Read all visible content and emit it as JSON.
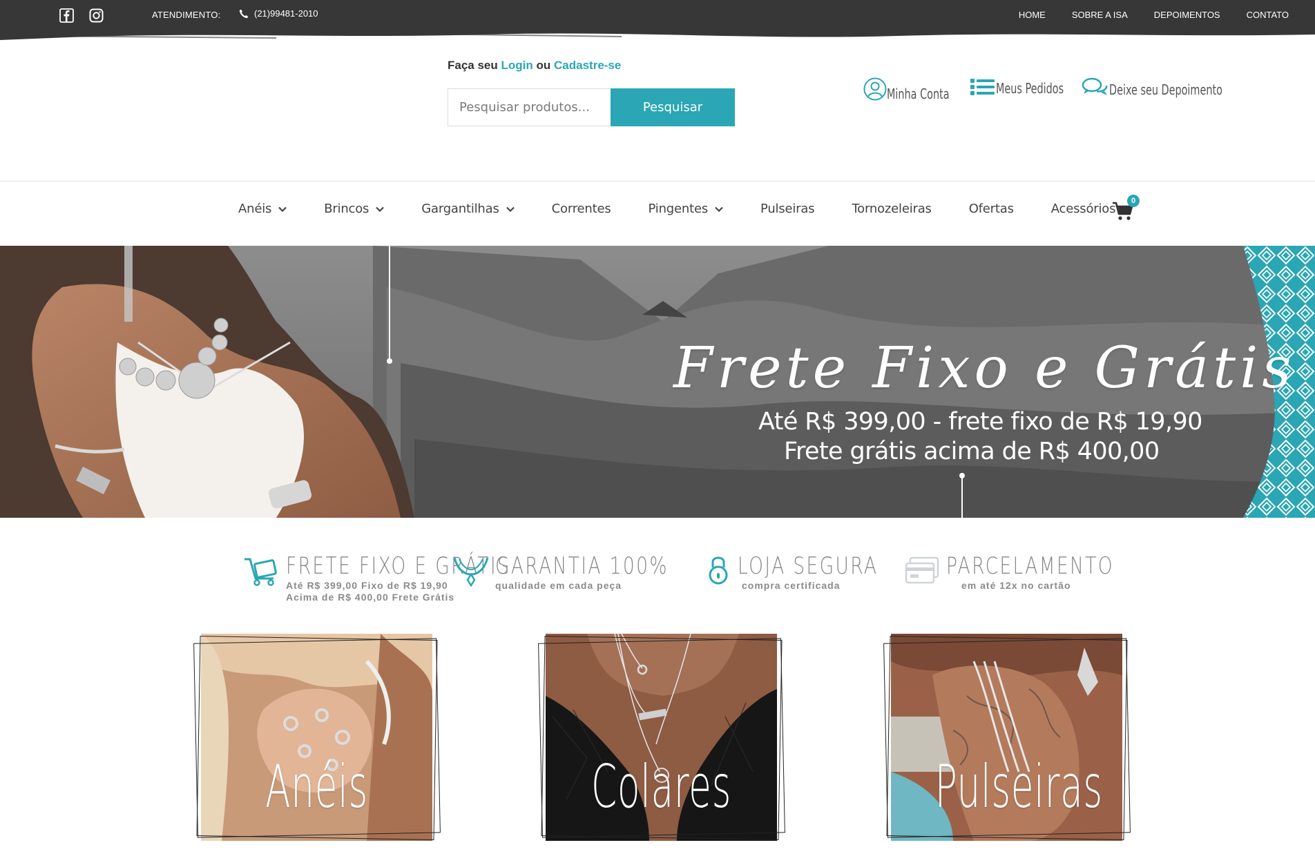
{
  "topbar": {
    "social": [
      {
        "icon": "facebook-icon"
      },
      {
        "icon": "instagram-icon"
      }
    ],
    "atendimento_label": "ATENDIMENTO:",
    "phone": "(21)99481-2010",
    "nav": [
      "HOME",
      "SOBRE A ISA",
      "DEPOIMENTOS",
      "CONTATO"
    ]
  },
  "header": {
    "login_prefix": "Faça seu",
    "login_link": "Login",
    "login_middle": "ou",
    "register_link": "Cadastre-se",
    "search": {
      "placeholder": "Pesquisar produtos...",
      "button": "Pesquisar"
    },
    "links": [
      {
        "label": "Minha Conta",
        "icon": "user-icon"
      },
      {
        "label": "Meus Pedidos",
        "icon": "list-icon"
      },
      {
        "label": "Deixe seu Depoimento",
        "icon": "chat-icon"
      }
    ]
  },
  "mainnav": {
    "items": [
      {
        "label": "Anéis",
        "dropdown": true
      },
      {
        "label": "Brincos",
        "dropdown": true
      },
      {
        "label": "Gargantilhas",
        "dropdown": true
      },
      {
        "label": "Correntes",
        "dropdown": false
      },
      {
        "label": "Pingentes",
        "dropdown": true
      },
      {
        "label": "Pulseiras",
        "dropdown": false
      },
      {
        "label": "Tornozeleiras",
        "dropdown": false
      },
      {
        "label": "Ofertas",
        "dropdown": false
      },
      {
        "label": "Acessórios",
        "dropdown": false
      }
    ],
    "cart_count": "0"
  },
  "banner": {
    "title": "Frete Fixo e Grátis",
    "line1": "Até R$ 399,00 - frete fixo de R$ 19,90",
    "line2": "Frete grátis acima de R$ 400,00"
  },
  "features": [
    {
      "title": "FRETE FIXO E GRÁTIS",
      "sub1": "Até R$ 399,00 Fixo de R$ 19,90",
      "sub2": "Acima de R$ 400,00 Frete Grátis",
      "icon": "delivery-cart-icon"
    },
    {
      "title": "GARANTIA 100%",
      "sub1": "qualidade em cada peça",
      "sub2": "",
      "icon": "necklace-icon"
    },
    {
      "title": "LOJA SEGURA",
      "sub1": "compra certificada",
      "sub2": "",
      "icon": "lock-icon"
    },
    {
      "title": "PARCELAMENTO",
      "sub1": "em até 12x no cartão",
      "sub2": "",
      "icon": "credit-card-icon"
    }
  ],
  "categories": [
    {
      "label": "Anéis"
    },
    {
      "label": "Colares"
    },
    {
      "label": "Pulseiras"
    }
  ],
  "colors": {
    "accent": "#2aa6b4",
    "topbar": "#373737"
  }
}
